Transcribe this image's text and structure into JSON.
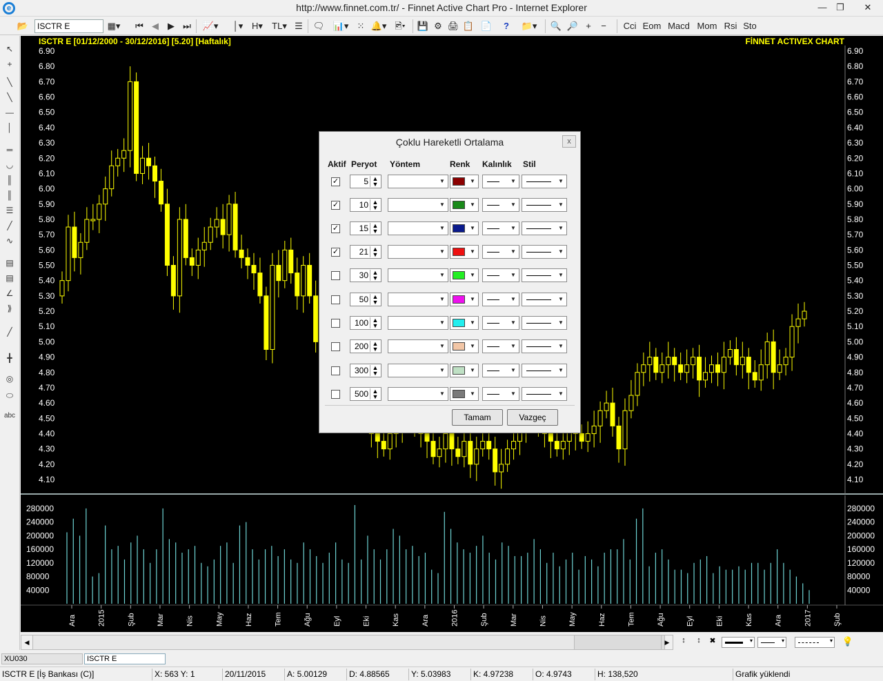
{
  "window": {
    "title": "http://www.finnet.com.tr/ - Finnet Active Chart Pro - Internet Explorer"
  },
  "toolbar": {
    "symbol": "ISCTR E",
    "h_label": "H",
    "tl_label": "TL",
    "indicators": [
      "Cci",
      "Eom",
      "Macd",
      "Mom",
      "Rsi",
      "Sto"
    ]
  },
  "left_tools": {
    "text_tool": "abc"
  },
  "chart": {
    "header": "ISCTR E  [01/12/2000 - 30/12/2016]  [5.20]  [Haftalık]",
    "brand": "FİNNET ACTIVEX CHART",
    "price_ticks": [
      "6.90",
      "6.80",
      "6.70",
      "6.60",
      "6.50",
      "6.40",
      "6.30",
      "6.20",
      "6.10",
      "6.00",
      "5.90",
      "5.80",
      "5.70",
      "5.60",
      "5.50",
      "5.40",
      "5.30",
      "5.20",
      "5.10",
      "5.00",
      "4.90",
      "4.80",
      "4.70",
      "4.60",
      "4.50",
      "4.40",
      "4.30",
      "4.20",
      "4.10"
    ],
    "volume_ticks": [
      "280000",
      "240000",
      "200000",
      "160000",
      "120000",
      "80000",
      "40000"
    ],
    "date_labels": [
      "Ara",
      "2015",
      "Şub",
      "Mar",
      "Nis",
      "May",
      "Haz",
      "Tem",
      "Ağu",
      "Eyl",
      "Eki",
      "Kas",
      "Ara",
      "2016",
      "Şub",
      "Mar",
      "Nis",
      "May",
      "Haz",
      "Tem",
      "Ağu",
      "Eyl",
      "Eki",
      "Kas",
      "Ara",
      "2017",
      "Şub"
    ],
    "candle_color": "#ffff00",
    "volume_color": "#6fd6d6"
  },
  "chart_data": {
    "type": "candlestick",
    "title": "ISCTR E  [01/12/2000 - 30/12/2016]  [5.20]  [Haftalık]",
    "ylim": [
      4.0,
      6.9
    ],
    "close": [
      5.4,
      5.75,
      5.55,
      5.65,
      5.8,
      5.8,
      5.9,
      6.0,
      6.15,
      6.2,
      6.25,
      6.7,
      6.1,
      6.2,
      6.15,
      6.05,
      5.9,
      5.5,
      5.3,
      5.8,
      5.55,
      5.5,
      5.6,
      5.65,
      5.75,
      5.8,
      5.7,
      5.9,
      5.6,
      5.55,
      5.5,
      5.45,
      5.3,
      4.95,
      5.5,
      5.4,
      5.6,
      5.45,
      5.3,
      5.5,
      5.3,
      5.0,
      5.15,
      4.9,
      5.0,
      4.8,
      4.75,
      4.7,
      4.55,
      4.5,
      4.4,
      4.35,
      4.3,
      4.4,
      4.45,
      4.5,
      4.55,
      4.45,
      4.4,
      4.35,
      4.25,
      4.3,
      4.4,
      4.3,
      4.25,
      4.35,
      4.2,
      4.3,
      4.35,
      4.3,
      4.15,
      4.2,
      4.3,
      4.35,
      4.45,
      4.5,
      4.55,
      4.45,
      4.4,
      4.35,
      4.3,
      4.35,
      4.45,
      4.4,
      4.35,
      4.4,
      4.45,
      4.55,
      4.6,
      4.45,
      4.3,
      4.55,
      4.65,
      4.8,
      4.85,
      4.9,
      4.8,
      4.85,
      4.9,
      4.85,
      4.8,
      4.85,
      4.9,
      4.75,
      4.8,
      4.85,
      4.8,
      4.9,
      4.95,
      4.85,
      4.9,
      4.8,
      4.75,
      4.85,
      5.0,
      4.8,
      4.85,
      4.9,
      5.1,
      5.15,
      5.2
    ],
    "volume": [
      210000,
      250000,
      200000,
      280000,
      80000,
      90000,
      230000,
      160000,
      170000,
      130000,
      180000,
      200000,
      160000,
      120000,
      160000,
      280000,
      190000,
      180000,
      150000,
      160000,
      170000,
      120000,
      110000,
      130000,
      170000,
      180000,
      120000,
      230000,
      240000,
      160000,
      130000,
      160000,
      170000,
      140000,
      160000,
      130000,
      120000,
      180000,
      160000,
      140000,
      120000,
      150000,
      180000,
      130000,
      120000,
      290000,
      130000,
      200000,
      160000,
      130000,
      160000,
      220000,
      200000,
      160000,
      170000,
      140000,
      150000,
      100000,
      90000,
      270000,
      220000,
      180000,
      160000,
      150000,
      170000,
      200000,
      150000,
      130000,
      180000,
      170000,
      140000,
      140000,
      150000,
      190000,
      160000,
      120000,
      150000,
      110000,
      130000,
      150000,
      100000,
      140000,
      130000,
      110000,
      150000,
      160000,
      160000,
      190000,
      130000,
      250000,
      280000,
      110000,
      150000,
      160000,
      130000,
      100000,
      100000,
      90000,
      120000,
      130000,
      140000,
      90000,
      110000,
      100000,
      100000,
      110000,
      100000,
      120000,
      120000,
      100000,
      120000,
      160000,
      120000,
      100000,
      80000,
      60000,
      40000
    ]
  },
  "dialog": {
    "title": "Çoklu Hareketli Ortalama",
    "close": "x",
    "headers": {
      "active": "Aktif",
      "period": "Peryot",
      "method": "Yöntem",
      "color": "Renk",
      "width": "Kalınlık",
      "style": "Stil"
    },
    "rows": [
      {
        "active": true,
        "period": "5",
        "color": "#8b0000"
      },
      {
        "active": true,
        "period": "10",
        "color": "#1a8a1a"
      },
      {
        "active": true,
        "period": "15",
        "color": "#0a1a8c"
      },
      {
        "active": true,
        "period": "21",
        "color": "#ee1111"
      },
      {
        "active": false,
        "period": "30",
        "color": "#22ee22"
      },
      {
        "active": false,
        "period": "50",
        "color": "#ee11ee"
      },
      {
        "active": false,
        "period": "100",
        "color": "#22eeee"
      },
      {
        "active": false,
        "period": "200",
        "color": "#f2c6a6"
      },
      {
        "active": false,
        "period": "300",
        "color": "#bfe0c4"
      },
      {
        "active": false,
        "period": "500",
        "color": "#7a7a7a"
      }
    ],
    "ok": "Tamam",
    "cancel": "Vazgeç"
  },
  "tabs": [
    "XU030",
    "ISCTR E"
  ],
  "status": {
    "symbol": "ISCTR E [İş Bankası (C)]",
    "xy": "X: 563 Y: 1",
    "date": "20/11/2015",
    "a": "A: 5.00129",
    "d": "D: 4.88565",
    "y": "Y: 5.03983",
    "k": "K: 4.97238",
    "o": "O: 4.9743",
    "h": "H: 138,520",
    "msg": "Grafik yüklendi"
  }
}
